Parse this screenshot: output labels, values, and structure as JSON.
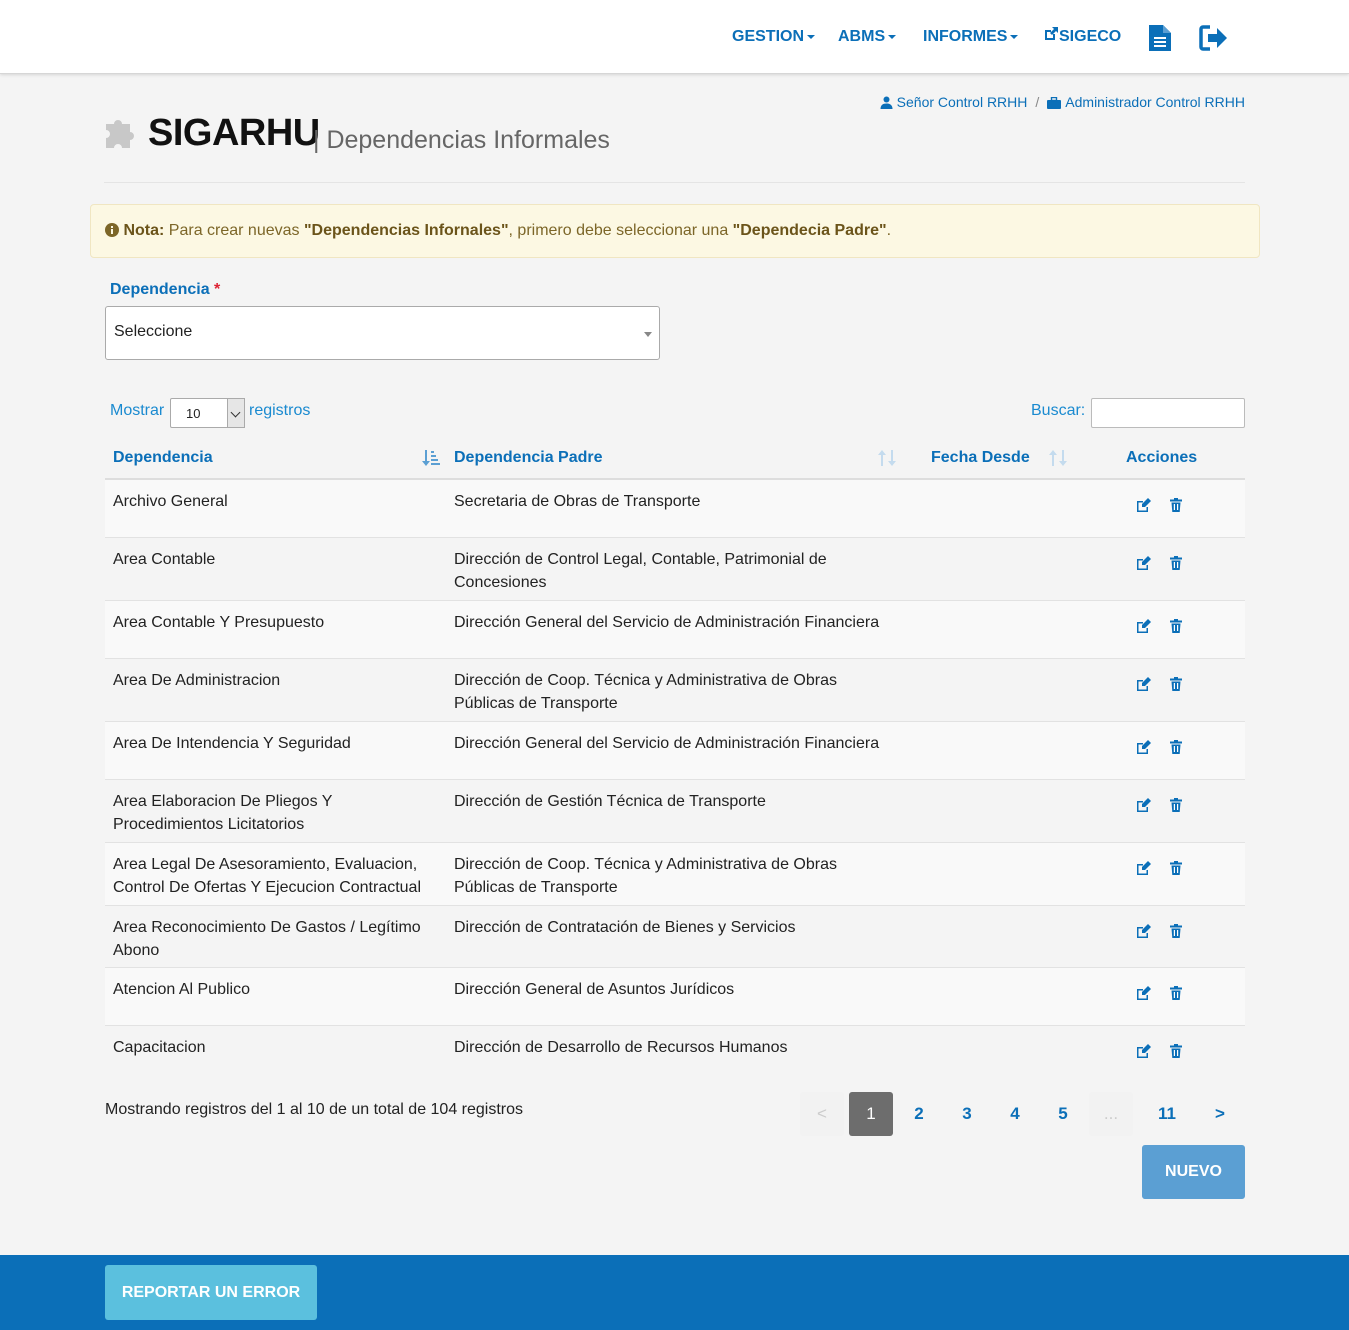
{
  "nav": {
    "gestion": "GESTION",
    "abms": "ABMS",
    "informes": "INFORMES",
    "sigeco": "SIGECO"
  },
  "breadcrumb": {
    "user": "Señor Control RRHH",
    "separator": "/",
    "role": "Administrador Control RRHH"
  },
  "header": {
    "app_title": "SIGARHU",
    "subtitle": "| Dependencias Informales"
  },
  "alert": {
    "note_label": "Nota:",
    "text_1": " Para crear nuevas ",
    "bold_1": "\"Dependencias Infornales\"",
    "text_2": ", primero debe seleccionar una ",
    "bold_2": "\"Dependecia Padre\"",
    "text_3": "."
  },
  "dependencia_field": {
    "label": "Dependencia",
    "required_mark": "*",
    "value": "Seleccione"
  },
  "table_controls": {
    "show_label": "Mostrar",
    "page_size": "10",
    "records_label": "registros",
    "search_label": "Buscar:"
  },
  "table": {
    "headers": [
      "Dependencia",
      "Dependencia Padre",
      "Fecha Desde",
      "Acciones"
    ],
    "rows": [
      {
        "dependencia": "Archivo General",
        "padre": "Secretaria de Obras de Transporte"
      },
      {
        "dependencia": "Area Contable",
        "padre": "Dirección de Control Legal, Contable, Patrimonial de Concesiones"
      },
      {
        "dependencia": "Area Contable Y Presupuesto",
        "padre": "Dirección General del Servicio de Administración Financiera"
      },
      {
        "dependencia": "Area De Administracion",
        "padre": "Dirección de Coop. Técnica y Administrativa de Obras Públicas de Transporte"
      },
      {
        "dependencia": "Area De Intendencia Y Seguridad",
        "padre": "Dirección General del Servicio de Administración Financiera"
      },
      {
        "dependencia": "Area Elaboracion De Pliegos Y Procedimientos Licitatorios",
        "padre": "Dirección de Gestión Técnica de Transporte"
      },
      {
        "dependencia": "Area Legal De Asesoramiento, Evaluacion, Control De Ofertas Y Ejecucion Contractual",
        "padre": "Dirección de Coop. Técnica y Administrativa de Obras Públicas de Transporte"
      },
      {
        "dependencia": "Area Reconocimiento De Gastos / Legítimo Abono",
        "padre": "Dirección de Contratación de Bienes y Servicios"
      },
      {
        "dependencia": "Atencion Al Publico",
        "padre": "Dirección General de Asuntos Jurídicos"
      },
      {
        "dependencia": "Capacitacion",
        "padre": "Dirección de Desarrollo de Recursos Humanos"
      }
    ]
  },
  "pagination": {
    "info": "Mostrando registros del 1 al 10 de un total de 104 registros",
    "prev": "<",
    "pages": [
      "1",
      "2",
      "3",
      "4",
      "5"
    ],
    "ellipsis": "...",
    "last": "11",
    "next": ">",
    "current": "1"
  },
  "buttons": {
    "nuevo": "NUEVO",
    "report": "REPORTAR UN ERROR"
  },
  "colors": {
    "primary": "#0b6fb8",
    "alert_bg": "#fcf8e3",
    "nuevo": "#5b9fd3",
    "report": "#5bc0de"
  }
}
